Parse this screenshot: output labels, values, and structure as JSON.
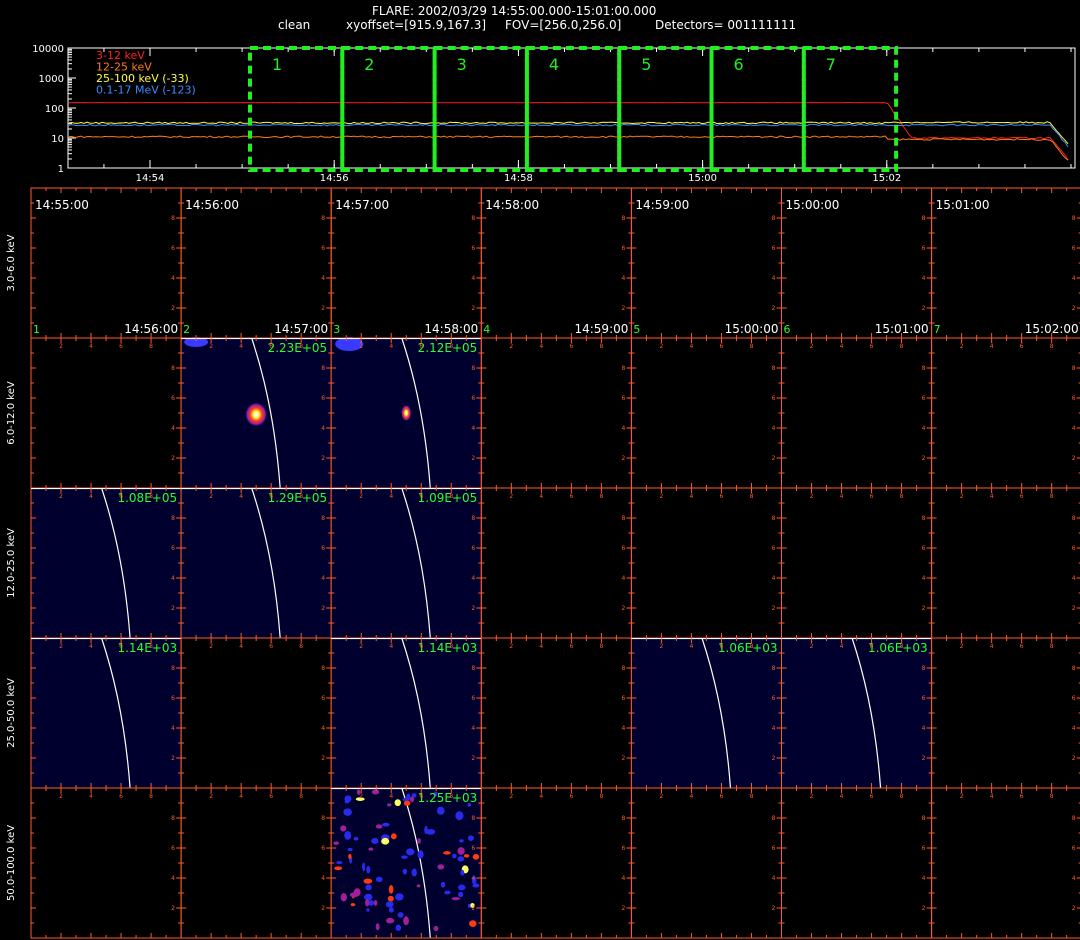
{
  "header": {
    "title": "FLARE: 2002/03/29 14:55:00.000-15:01:00.000",
    "method": "clean",
    "xyoffset": "xyoffset=[915.9,167.3]",
    "fov": "FOV=[256.0,256.0]",
    "detectors": "Detectors= 001111111"
  },
  "colors": {
    "axis": "#ff5a2a",
    "interval_box": "#22ee22",
    "label_green": "#2bff2b",
    "panel_bg": "#00002e",
    "limb": "#ffffff"
  },
  "chart_data": [
    {
      "type": "line",
      "yscale": "log",
      "ylim": [
        1,
        10000
      ],
      "yticks": [
        "1",
        "10",
        "100",
        "1000",
        "10000"
      ],
      "xticks": [
        "14:54",
        "14:56",
        "14:58",
        "15:00",
        "15:02"
      ],
      "series": [
        {
          "name": "3-12 keV",
          "color": "#ff2020",
          "level": 150,
          "after_level": 10
        },
        {
          "name": "12-25 keV",
          "color": "#ff7a20",
          "level": 11,
          "after_level": 9
        },
        {
          "name": "25-100 keV (-33)",
          "color": "#ffff40",
          "level": 32,
          "after_level": 33
        },
        {
          "name": "0.1-17 MeV (-123)",
          "color": "#3a8cff",
          "level": 27,
          "after_level": 27
        }
      ],
      "intervals": [
        "1",
        "2",
        "3",
        "4",
        "5",
        "6",
        "7"
      ]
    },
    {
      "type": "heatmap",
      "rows": [
        "3.0-6.0 keV",
        "6.0-12.0 keV",
        "12.0-25.0 keV",
        "25.0-50.0 keV",
        "50.0-100.0 keV"
      ],
      "col_start_times": [
        "14:55:00",
        "14:56:00",
        "14:57:00",
        "14:58:00",
        "14:59:00",
        "15:00:00",
        "15:01:00"
      ],
      "col_end_times": [
        "14:56:00",
        "14:57:00",
        "14:58:00",
        "14:59:00",
        "15:00:00",
        "15:01:00",
        "15:02:00"
      ],
      "col_numbers": [
        "1",
        "2",
        "3",
        "4",
        "5",
        "6",
        "7"
      ],
      "tick_labels": [
        "2",
        "4",
        "6",
        "8"
      ],
      "images": [
        {
          "row": 1,
          "col": 1,
          "max": "2.23E+05",
          "source": "bright"
        },
        {
          "row": 1,
          "col": 2,
          "max": "2.12E+05",
          "source": "faint"
        },
        {
          "row": 2,
          "col": 0,
          "max": "1.08E+05"
        },
        {
          "row": 2,
          "col": 1,
          "max": "1.29E+05"
        },
        {
          "row": 2,
          "col": 2,
          "max": "1.09E+05"
        },
        {
          "row": 3,
          "col": 0,
          "max": "1.14E+03"
        },
        {
          "row": 3,
          "col": 2,
          "max": "1.14E+03"
        },
        {
          "row": 3,
          "col": 4,
          "max": "1.06E+03"
        },
        {
          "row": 3,
          "col": 5,
          "max": "1.06E+03"
        },
        {
          "row": 4,
          "col": 2,
          "max": "1.25E+03",
          "source": "noise"
        }
      ]
    }
  ]
}
